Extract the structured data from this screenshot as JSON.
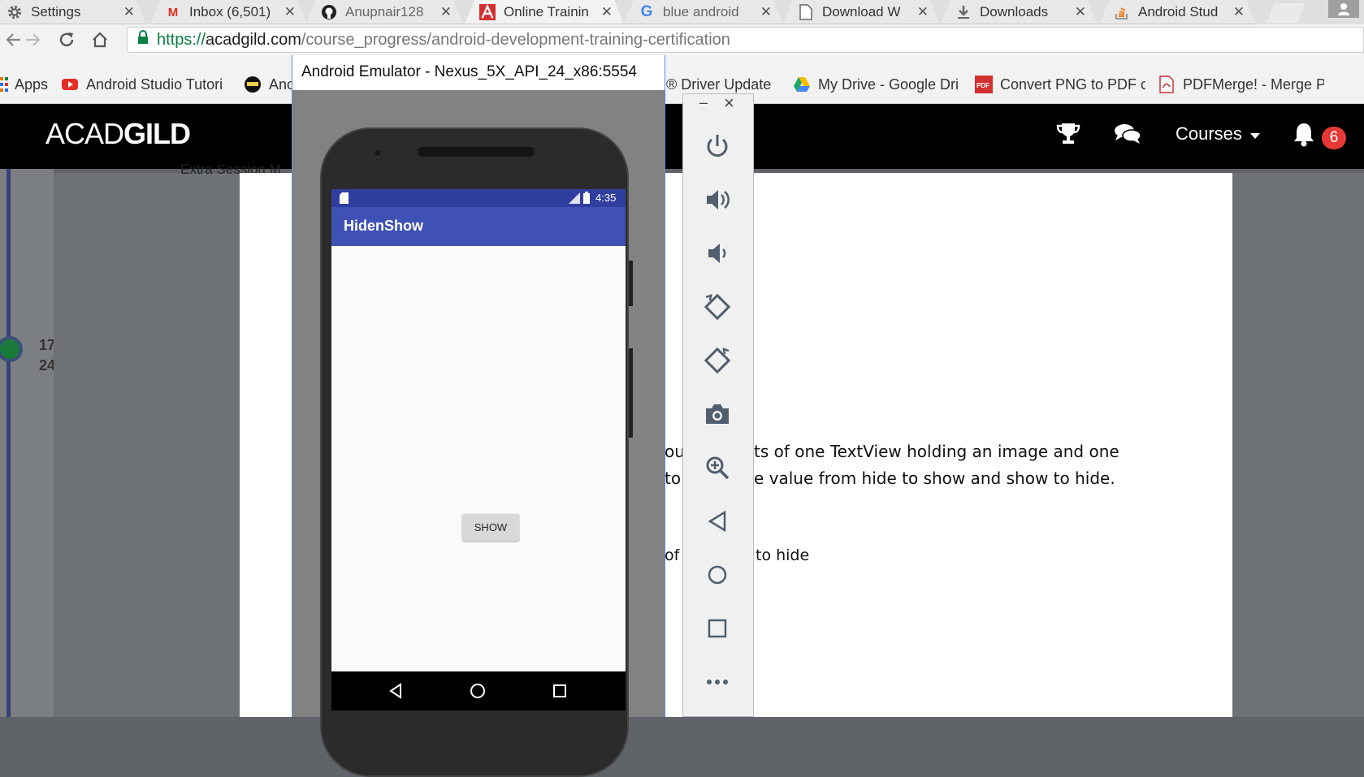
{
  "tabs": [
    {
      "title": "Settings",
      "icon": "gear-icon",
      "active": false
    },
    {
      "title": "Inbox (6,501)",
      "icon": "gmail-icon",
      "active": false
    },
    {
      "title": "Anupnair128",
      "icon": "github-icon",
      "active": false
    },
    {
      "title": "Online Trainin",
      "icon": "acadgild-icon",
      "active": true
    },
    {
      "title": "blue android",
      "icon": "google-icon",
      "active": false
    },
    {
      "title": "Download W",
      "icon": "document-icon",
      "active": false
    },
    {
      "title": "Downloads",
      "icon": "download-icon",
      "active": false
    },
    {
      "title": "Android Stud",
      "icon": "stackoverflow-icon",
      "active": false
    }
  ],
  "address_bar": {
    "scheme": "https://",
    "host": "acadgild.com",
    "path": "/course_progress/android-development-training-certification"
  },
  "bookmarks": [
    {
      "label": "Apps"
    },
    {
      "label": "Android Studio Tutori"
    },
    {
      "label": "Anc"
    },
    {
      "label": "® Driver Update"
    },
    {
      "label": "My Drive - Google Dri"
    },
    {
      "label": "Convert PNG to PDF c"
    },
    {
      "label": "PDFMerge! - Merge P"
    }
  ],
  "site": {
    "logo_light": "ACAD",
    "logo_bold": "GILD",
    "courses_label": "Courses",
    "notification_count": "6"
  },
  "page": {
    "left_numbers": [
      "17",
      "24"
    ],
    "stray_text": "Extra Session M",
    "line1_a": "ou",
    "line1_b": "ts of one TextView holding an image and one",
    "line2_a": "to",
    "line2_b": "e value from hide to show and show to hide.",
    "line3_a": "of",
    "line3_b": "to hide"
  },
  "emulator": {
    "window_title": "Android Emulator - Nexus_5X_API_24_x86:5554",
    "minimize": "–",
    "close": "×",
    "time": "4:35",
    "app_title": "HidenShow",
    "button_label": "SHOW",
    "tools": [
      "power-icon",
      "volume-up-icon",
      "volume-down-icon",
      "rotate-left-icon",
      "rotate-right-icon",
      "camera-icon",
      "zoom-icon",
      "back-icon",
      "home-icon",
      "overview-icon",
      "more-icon"
    ]
  },
  "colors": {
    "app_bar": "#3f51b5",
    "status_bar": "#303f9f",
    "site_header": "#000000",
    "badge": "#e53935"
  }
}
